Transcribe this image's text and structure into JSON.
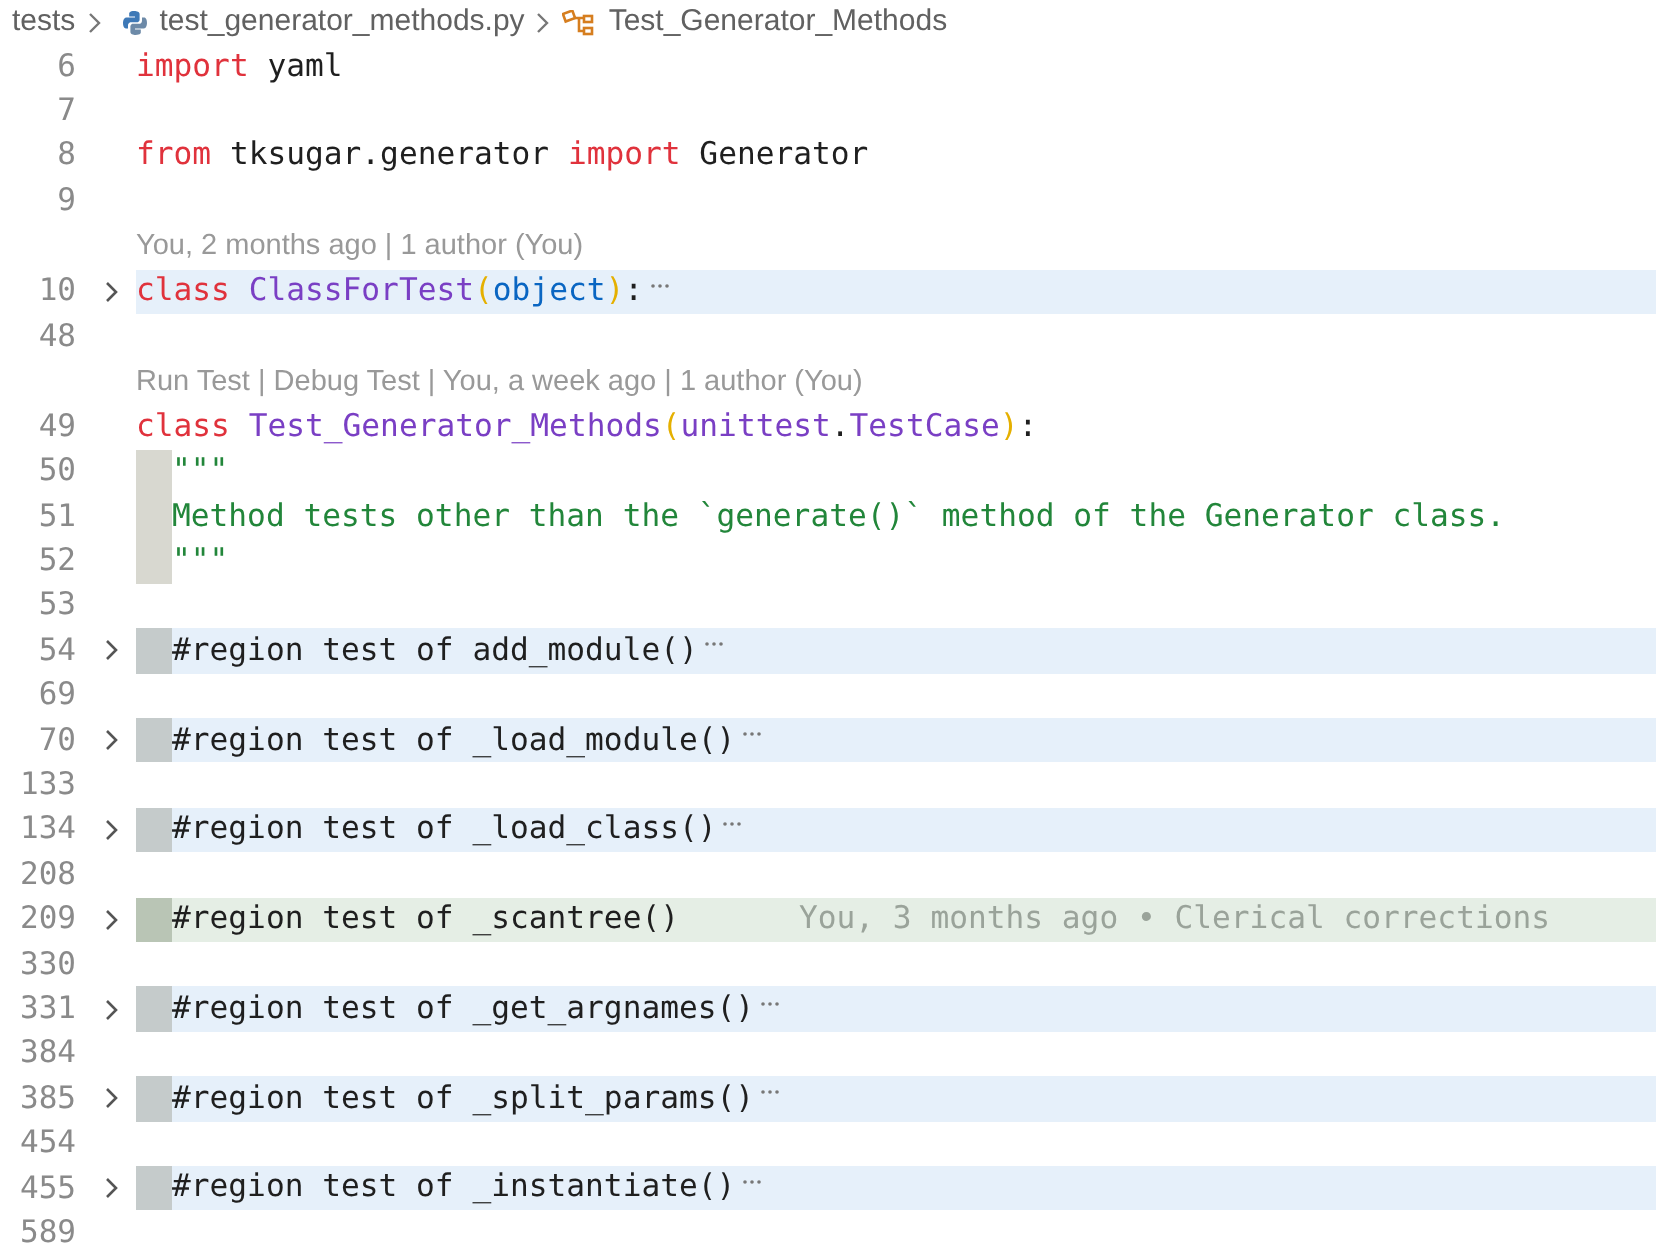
{
  "breadcrumb": {
    "folder": "tests",
    "file": "test_generator_methods.py",
    "symbol": "Test_Generator_Methods"
  },
  "lines": [
    {
      "kind": "code",
      "number": "6",
      "tokens": [
        {
          "text": "import",
          "kind": "keyword"
        },
        {
          "text": " yaml",
          "kind": "plain"
        }
      ]
    },
    {
      "kind": "code",
      "number": "7"
    },
    {
      "kind": "code",
      "number": "8",
      "tokens": [
        {
          "text": "from",
          "kind": "keyword"
        },
        {
          "text": " tksugar.generator ",
          "kind": "plain"
        },
        {
          "text": "import",
          "kind": "keyword"
        },
        {
          "text": " Generator",
          "kind": "plain"
        }
      ]
    },
    {
      "kind": "code",
      "number": "9"
    },
    {
      "kind": "lens",
      "text": "You, 2 months ago | 1 author (You)"
    },
    {
      "kind": "code",
      "number": "10",
      "folded": true,
      "tokens": [
        {
          "text": "class",
          "kind": "keyword"
        },
        {
          "text": " ClassForTest",
          "kind": "classname"
        },
        {
          "text": "(",
          "kind": "bracket"
        },
        {
          "text": "object",
          "kind": "builtin"
        },
        {
          "text": ")",
          "kind": "bracket"
        },
        {
          "text": ":",
          "kind": "plain"
        }
      ]
    },
    {
      "kind": "code",
      "number": "48"
    },
    {
      "kind": "lens",
      "text": "Run Test | Debug Test | You, a week ago | 1 author (You)"
    },
    {
      "kind": "code",
      "number": "49",
      "tokens": [
        {
          "text": "class",
          "kind": "keyword"
        },
        {
          "text": " Test_Generator_Methods",
          "kind": "classname"
        },
        {
          "text": "(",
          "kind": "bracket"
        },
        {
          "text": "unittest",
          "kind": "classname"
        },
        {
          "text": ".",
          "kind": "plain"
        },
        {
          "text": "TestCase",
          "kind": "classname"
        },
        {
          "text": ")",
          "kind": "bracket"
        },
        {
          "text": ":",
          "kind": "plain"
        }
      ]
    },
    {
      "kind": "code",
      "number": "50",
      "guide": true,
      "tokens": [
        {
          "text": "\"\"\"",
          "kind": "string"
        }
      ]
    },
    {
      "kind": "code",
      "number": "51",
      "guide": true,
      "tokens": [
        {
          "text": "Method tests other than the `generate()` method of the Generator class.",
          "kind": "string"
        }
      ]
    },
    {
      "kind": "code",
      "number": "52",
      "guide": true,
      "tokens": [
        {
          "text": "\"\"\"",
          "kind": "string"
        }
      ]
    },
    {
      "kind": "code",
      "number": "53"
    },
    {
      "kind": "code",
      "number": "54",
      "folded": true,
      "guide": true,
      "tokens": [
        {
          "text": "#region test of add_module()",
          "kind": "plain"
        }
      ]
    },
    {
      "kind": "code",
      "number": "69"
    },
    {
      "kind": "code",
      "number": "70",
      "folded": true,
      "guide": true,
      "tokens": [
        {
          "text": "#region test of _load_module()",
          "kind": "plain"
        }
      ]
    },
    {
      "kind": "code",
      "number": "133"
    },
    {
      "kind": "code",
      "number": "134",
      "folded": true,
      "guide": true,
      "tokens": [
        {
          "text": "#region test of _load_class()",
          "kind": "plain"
        }
      ]
    },
    {
      "kind": "code",
      "number": "208"
    },
    {
      "kind": "code",
      "number": "209",
      "folded": true,
      "guide": true,
      "current": true,
      "blame": "You, 3 months ago • Clerical corrections",
      "tokens": [
        {
          "text": "#region test of _scantree()",
          "kind": "plain"
        }
      ]
    },
    {
      "kind": "code",
      "number": "330"
    },
    {
      "kind": "code",
      "number": "331",
      "folded": true,
      "guide": true,
      "tokens": [
        {
          "text": "#region test of _get_argnames()",
          "kind": "plain"
        }
      ]
    },
    {
      "kind": "code",
      "number": "384"
    },
    {
      "kind": "code",
      "number": "385",
      "folded": true,
      "guide": true,
      "tokens": [
        {
          "text": "#region test of _split_params()",
          "kind": "plain"
        }
      ]
    },
    {
      "kind": "code",
      "number": "454"
    },
    {
      "kind": "code",
      "number": "455",
      "folded": true,
      "guide": true,
      "tokens": [
        {
          "text": "#region test of _instantiate()",
          "kind": "plain"
        }
      ]
    },
    {
      "kind": "code",
      "number": "589"
    }
  ]
}
